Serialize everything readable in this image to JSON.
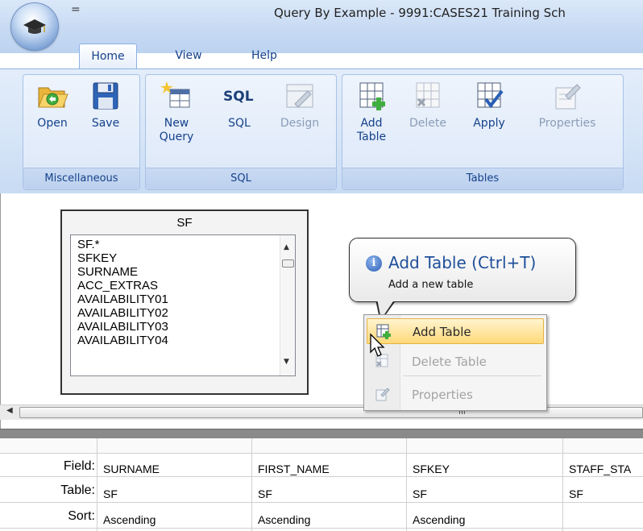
{
  "window": {
    "title": "Query By Example - 9991:CASES21 Training Sch",
    "qat_symbol": "="
  },
  "tabs": [
    {
      "label": "Home",
      "active": true
    },
    {
      "label": "View",
      "active": false
    },
    {
      "label": "Help",
      "active": false
    }
  ],
  "ribbon": {
    "groups": [
      {
        "label": "Miscellaneous",
        "buttons": [
          {
            "label": "Open",
            "icon": "open-folder-icon",
            "enabled": true
          },
          {
            "label": "Save",
            "icon": "save-floppy-icon",
            "enabled": true
          }
        ]
      },
      {
        "label": "SQL",
        "buttons": [
          {
            "label": "New Query",
            "icon": "new-query-icon",
            "enabled": true
          },
          {
            "label": "SQL",
            "icon": "sql-icon",
            "enabled": true
          },
          {
            "label": "Design",
            "icon": "design-icon",
            "enabled": false
          }
        ]
      },
      {
        "label": "Tables",
        "buttons": [
          {
            "label": "Add Table",
            "icon": "add-table-icon",
            "enabled": true
          },
          {
            "label": "Delete",
            "icon": "delete-table-icon",
            "enabled": false
          },
          {
            "label": "Apply",
            "icon": "apply-icon",
            "enabled": true
          },
          {
            "label": "Properties",
            "icon": "properties-icon",
            "enabled": false
          }
        ]
      }
    ]
  },
  "diagram": {
    "table": {
      "name": "SF",
      "fields": [
        "SF.*",
        "SFKEY",
        "SURNAME",
        "ACC_EXTRAS",
        "AVAILABILITY01",
        "AVAILABILITY02",
        "AVAILABILITY03",
        "AVAILABILITY04"
      ]
    },
    "scroll_grip": "III"
  },
  "tooltip": {
    "title": "Add Table (Ctrl+T)",
    "description": "Add a new table",
    "icon": "info-icon"
  },
  "context_menu": {
    "items": [
      {
        "label": "Add Table",
        "icon": "add-table-icon",
        "enabled": true,
        "highlighted": true
      },
      {
        "label": "Delete Table",
        "icon": "delete-table-icon",
        "enabled": false,
        "highlighted": false
      },
      {
        "label": "Properties",
        "icon": "properties-icon",
        "enabled": false,
        "highlighted": false
      }
    ]
  },
  "grid": {
    "row_labels": [
      "Field:",
      "Table:",
      "Sort:"
    ],
    "columns": [
      {
        "field": "SURNAME",
        "table": "SF",
        "sort": "Ascending"
      },
      {
        "field": "FIRST_NAME",
        "table": "SF",
        "sort": "Ascending"
      },
      {
        "field": "SFKEY",
        "table": "SF",
        "sort": "Ascending"
      },
      {
        "field": "STAFF_STA",
        "table": "SF",
        "sort": ""
      }
    ]
  },
  "colors": {
    "ribbon_text": "#15428b",
    "menu_highlight": "#ffd979",
    "tooltip_title": "#1f4f9a"
  }
}
